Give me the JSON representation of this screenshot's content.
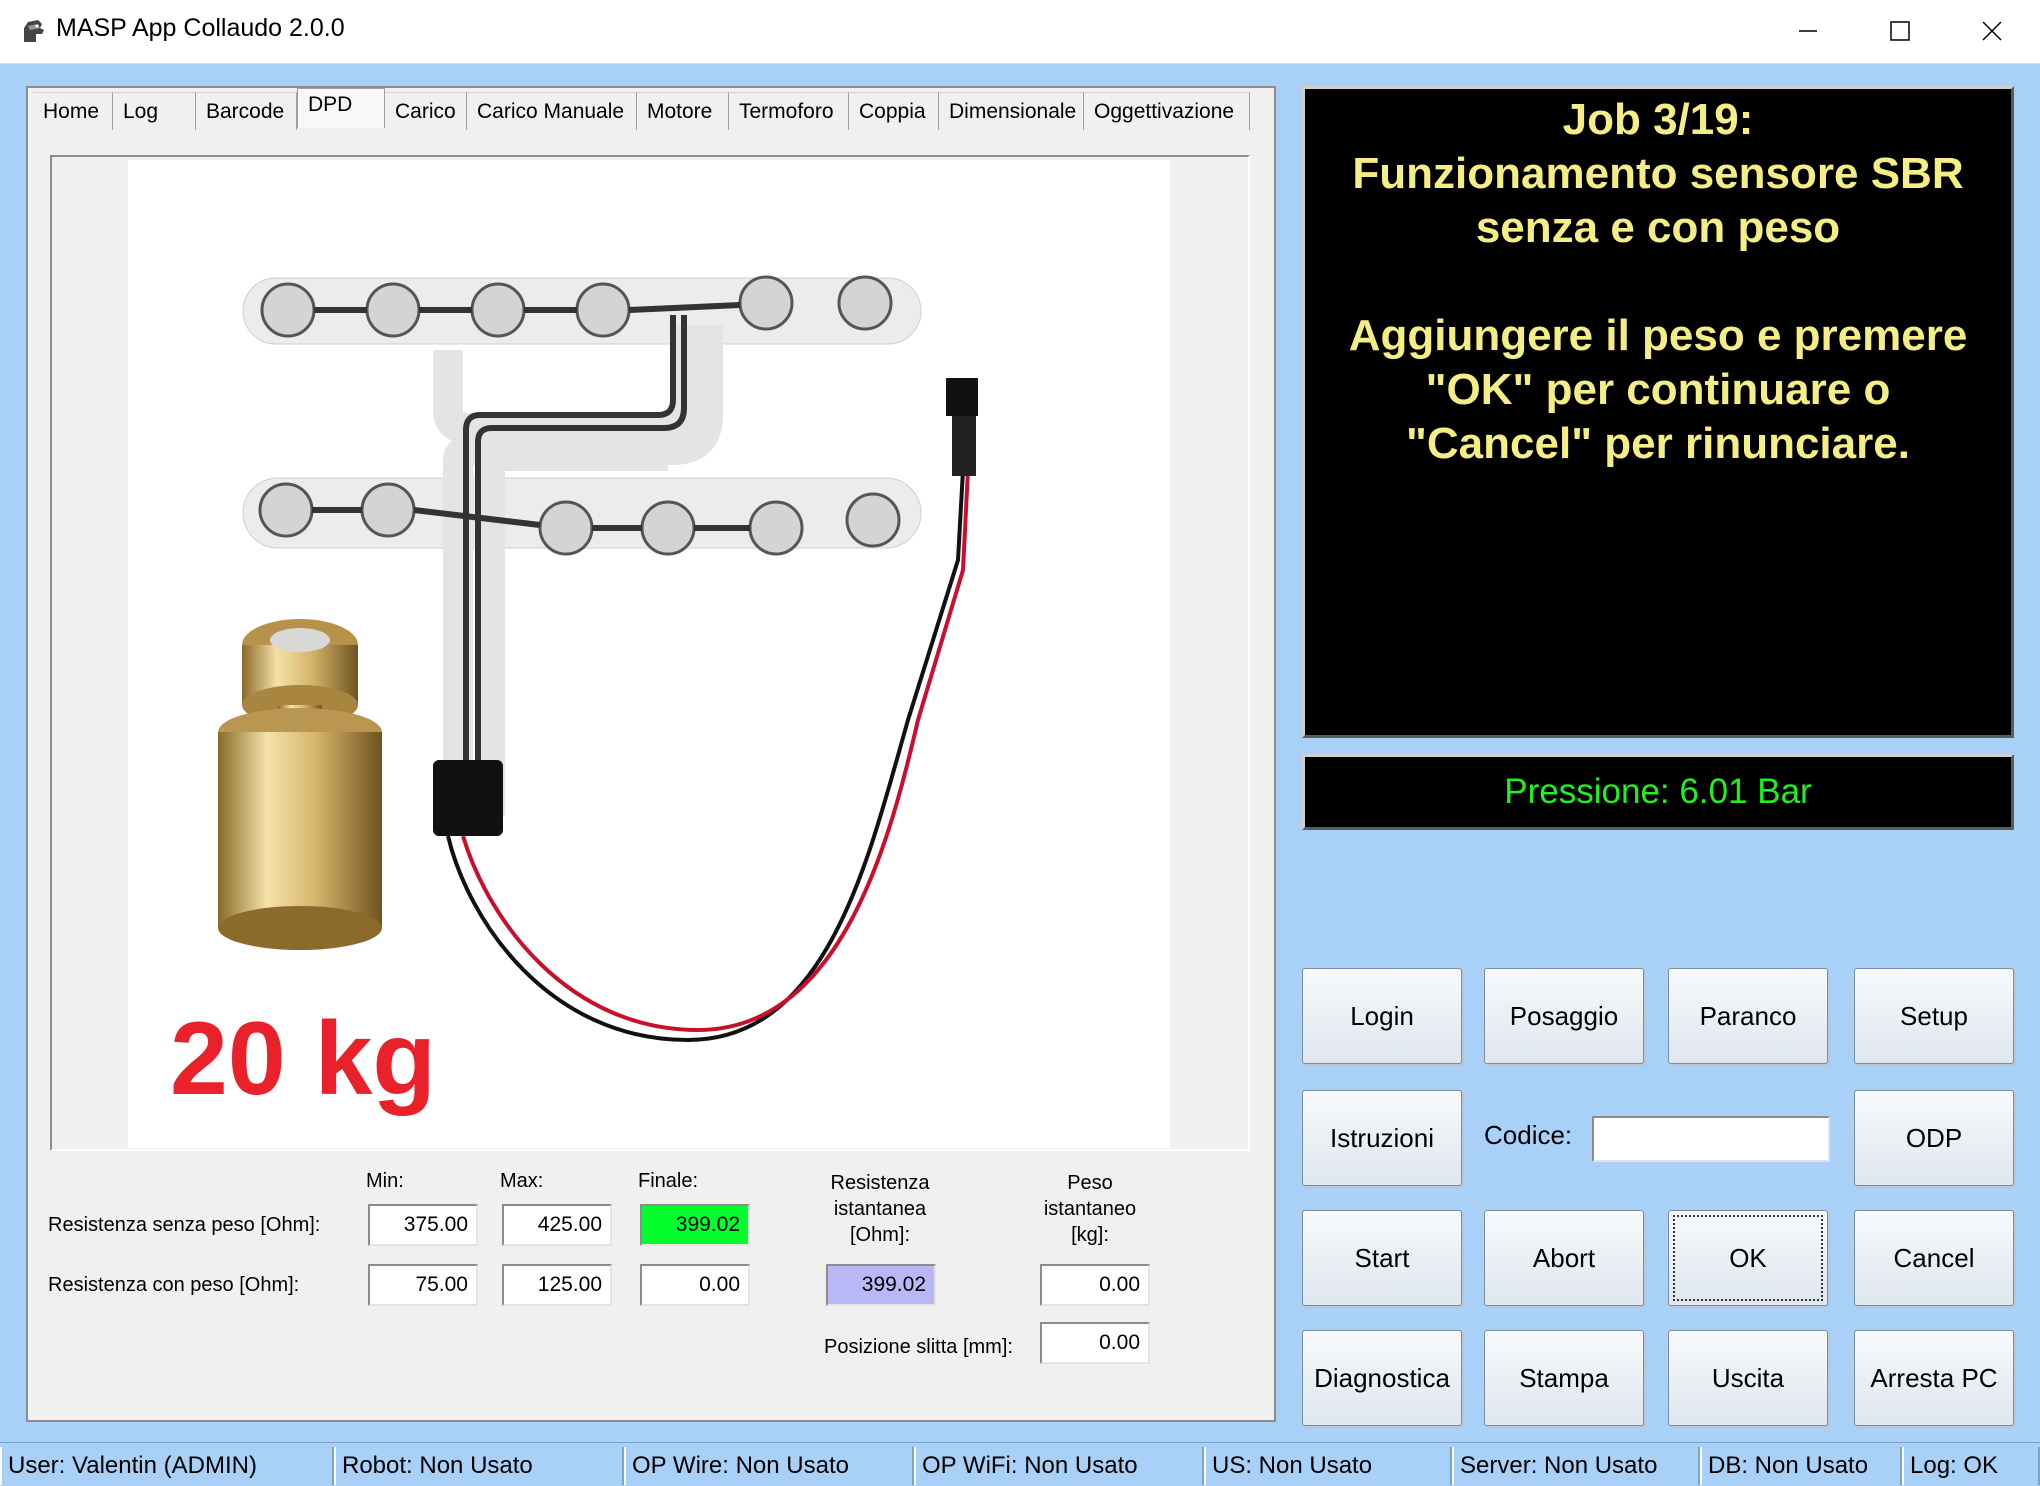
{
  "window": {
    "title": "MASP App Collaudo 2.0.0",
    "minimize": "—",
    "maximize": "☐",
    "close": "✕"
  },
  "tabs": [
    "Home",
    "Log",
    "Barcode",
    "DPD",
    "Carico",
    "Carico Manuale",
    "Motore",
    "Termoforo",
    "Coppia",
    "Dimensionale",
    "Oggettivazione"
  ],
  "active_tab": "DPD",
  "illustration": {
    "weight_label": "20 kg"
  },
  "form": {
    "col_min": "Min:",
    "col_max": "Max:",
    "col_final": "Finale:",
    "col_resistance": "Resistenza\nistantanea\n[Ohm]:",
    "col_weight": "Peso\nistantaneo\n[kg]:",
    "row1_label": "Resistenza senza peso [Ohm]:",
    "row2_label": "Resistenza con peso [Ohm]:",
    "row1_min": "375.00",
    "row1_max": "425.00",
    "row1_final": "399.02",
    "row2_min": "75.00",
    "row2_max": "125.00",
    "row2_final": "0.00",
    "instant_resistance": "399.02",
    "instant_weight": "0.00",
    "slide_label": "Posizione slitta [mm]:",
    "slide_value": "0.00"
  },
  "message": {
    "line1": "Job 3/19:",
    "line2": "Funzionamento sensore SBR",
    "line3": "senza e con peso",
    "line4": "Aggiungere il peso e premere",
    "line5": "\"OK\" per continuare o",
    "line6": "\"Cancel\" per rinunciare."
  },
  "pressure": "Pressione: 6.01 Bar",
  "buttons": {
    "login": "Login",
    "posaggio": "Posaggio",
    "paranco": "Paranco",
    "setup": "Setup",
    "istruzioni": "Istruzioni",
    "odp": "ODP",
    "start": "Start",
    "abort": "Abort",
    "ok": "OK",
    "cancel": "Cancel",
    "diagnostica": "Diagnostica",
    "stampa": "Stampa",
    "uscita": "Uscita",
    "arresta": "Arresta PC"
  },
  "codice": {
    "label": "Codice:",
    "value": ""
  },
  "status": {
    "user": "User: Valentin (ADMIN)",
    "robot": "Robot: Non Usato",
    "op_wire": "OP Wire: Non Usato",
    "op_wifi": "OP WiFi: Non Usato",
    "us": "US: Non Usato",
    "server": "Server: Non Usato",
    "db": "DB: Non Usato",
    "log": "Log: OK"
  },
  "colors": {
    "background": "#a9d1f7",
    "message_text": "#f4ee85",
    "pressure_text": "#1ef21e",
    "final_ok": "#00ff2c",
    "instant": "#b9b7f6",
    "weight_label": "#e8212b"
  }
}
